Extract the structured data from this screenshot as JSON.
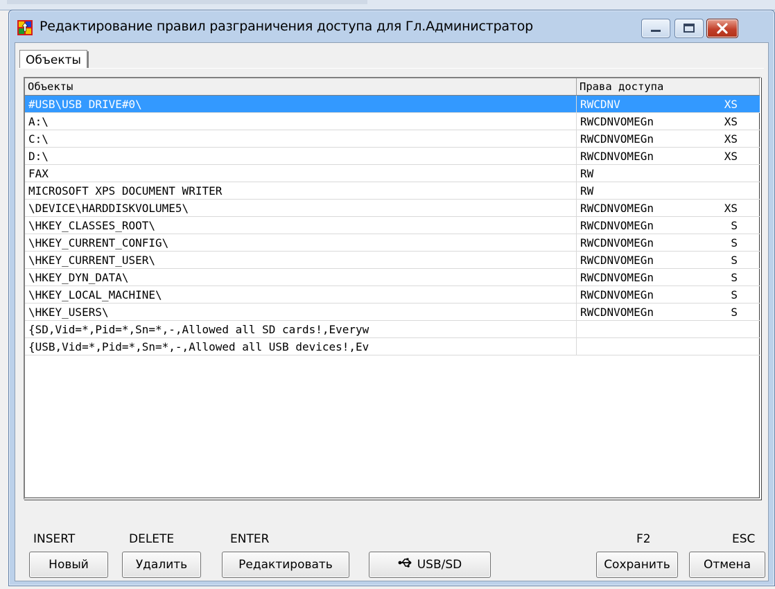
{
  "window": {
    "title": "Редактирование правил разграничения доступа для Гл.Администратор"
  },
  "tabs": [
    {
      "label": "Объекты",
      "active": true
    }
  ],
  "grid": {
    "columns": [
      "Объекты",
      "Права доступа"
    ],
    "rows": [
      {
        "object": "#USB\\USB DRIVE#0\\",
        "rights": "RWCDNV",
        "flags": "XS",
        "selected": true
      },
      {
        "object": "A:\\",
        "rights": "RWCDNVOMEGn",
        "flags": "XS"
      },
      {
        "object": "C:\\",
        "rights": "RWCDNVOMEGn",
        "flags": "XS"
      },
      {
        "object": "D:\\",
        "rights": "RWCDNVOMEGn",
        "flags": "XS"
      },
      {
        "object": "FAX",
        "rights": "RW",
        "flags": ""
      },
      {
        "object": "MICROSOFT XPS DOCUMENT WRITER",
        "rights": "RW",
        "flags": ""
      },
      {
        "object": "\\DEVICE\\HARDDISKVOLUME5\\",
        "rights": "RWCDNVOMEGn",
        "flags": "XS"
      },
      {
        "object": "\\HKEY_CLASSES_ROOT\\",
        "rights": "RWCDNVOMEGn",
        "flags": "S"
      },
      {
        "object": "\\HKEY_CURRENT_CONFIG\\",
        "rights": "RWCDNVOMEGn",
        "flags": "S"
      },
      {
        "object": "\\HKEY_CURRENT_USER\\",
        "rights": "RWCDNVOMEGn",
        "flags": "S"
      },
      {
        "object": "\\HKEY_DYN_DATA\\",
        "rights": "RWCDNVOMEGn",
        "flags": "S"
      },
      {
        "object": "\\HKEY_LOCAL_MACHINE\\",
        "rights": "RWCDNVOMEGn",
        "flags": "S"
      },
      {
        "object": "\\HKEY_USERS\\",
        "rights": "RWCDNVOMEGn",
        "flags": "S"
      },
      {
        "object": "{SD,Vid=*,Pid=*,Sn=*,-,Allowed all SD cards!,Everyw",
        "rights": "",
        "flags": ""
      },
      {
        "object": "{USB,Vid=*,Pid=*,Sn=*,-,Allowed all USB devices!,Ev",
        "rights": "",
        "flags": ""
      }
    ]
  },
  "hotkeys": {
    "insert": "INSERT",
    "delete": "DELETE",
    "enter": "ENTER",
    "f2": "F2",
    "esc": "ESC"
  },
  "buttons": {
    "new": "Новый",
    "delete": "Удалить",
    "edit": "Редактировать",
    "usb": "USB/SD",
    "save": "Сохранить",
    "cancel": "Отмена"
  },
  "colors": {
    "selection": "#3399ff",
    "close_button": "#c2402a"
  },
  "icons": {
    "app": "app-icon",
    "usb": "usb-icon"
  }
}
